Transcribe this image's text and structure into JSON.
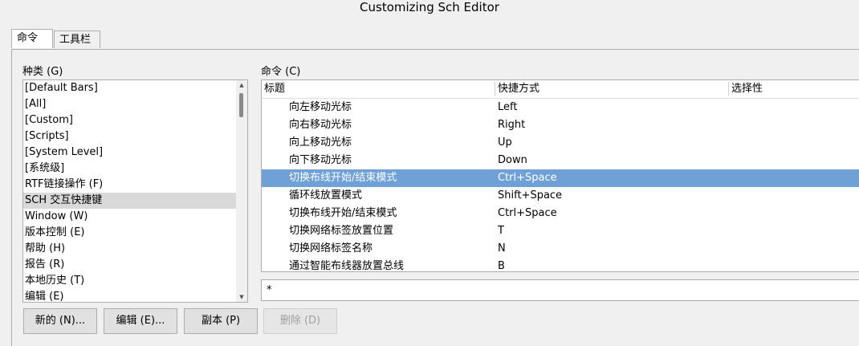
{
  "window": {
    "title": "Customizing Sch Editor"
  },
  "tabs": [
    {
      "label": "命令"
    },
    {
      "label": "工具栏"
    }
  ],
  "categories": {
    "label": "种类 (G)",
    "items": [
      "[Default Bars]",
      "[All]",
      "[Custom]",
      "[Scripts]",
      "[System Level]",
      "[系统级]",
      "RTF链接操作 (F)",
      "SCH 交互快捷键",
      "Window (W)",
      "版本控制 (E)",
      "帮助 (H)",
      "报告 (R)",
      "本地历史 (T)",
      "编辑 (E)"
    ],
    "selected": "SCH 交互快捷键"
  },
  "commands": {
    "label": "命令 (C)",
    "columns": [
      "标题",
      "快捷方式",
      "选择性"
    ],
    "rows": [
      {
        "title": "向左移动光标",
        "shortcut": "Left",
        "selective": ""
      },
      {
        "title": "向右移动光标",
        "shortcut": "Right",
        "selective": ""
      },
      {
        "title": "向上移动光标",
        "shortcut": "Up",
        "selective": ""
      },
      {
        "title": "向下移动光标",
        "shortcut": "Down",
        "selective": ""
      },
      {
        "title": "切换布线开始/结束模式",
        "shortcut": "Ctrl+Space",
        "selective": ""
      },
      {
        "title": "循环线放置模式",
        "shortcut": "Shift+Space",
        "selective": ""
      },
      {
        "title": "切换布线开始/结束模式",
        "shortcut": "Ctrl+Space",
        "selective": ""
      },
      {
        "title": "切换网络标签放置位置",
        "shortcut": "T",
        "selective": ""
      },
      {
        "title": "切换网络标签名称",
        "shortcut": "N",
        "selective": ""
      },
      {
        "title": "通过智能布线器放置总线",
        "shortcut": "B",
        "selective": ""
      }
    ],
    "selected_index": 4
  },
  "filter": {
    "value": "*"
  },
  "buttons": {
    "new": "新的 (N)...",
    "edit": "编辑 (E)...",
    "copy": "副本 (P)",
    "delete": "删除 (D)"
  },
  "colors": {
    "selected_row": "#6fa1d6",
    "selected_list_item": "#d9d9d9"
  }
}
